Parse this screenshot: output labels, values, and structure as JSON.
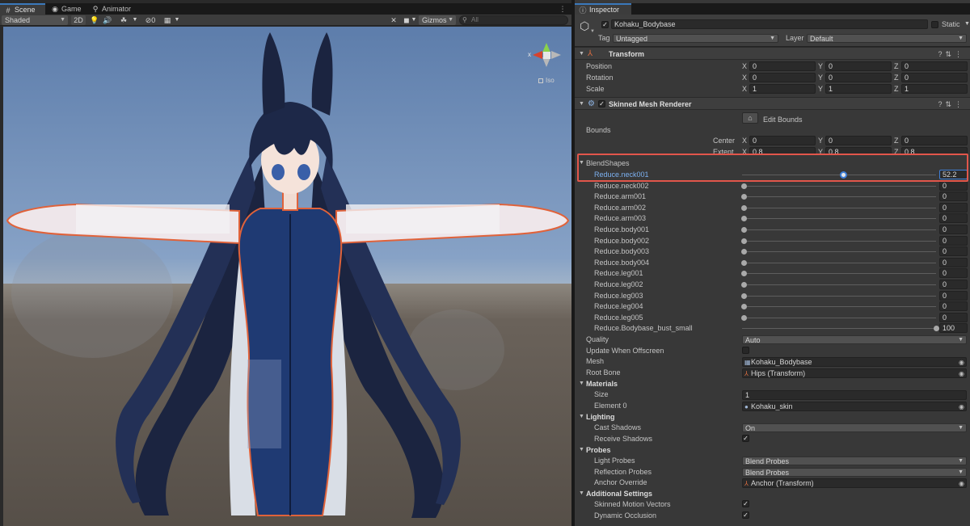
{
  "scene_tabs": [
    {
      "label": "Scene",
      "icon": "#"
    },
    {
      "label": "Game",
      "icon": "◉"
    },
    {
      "label": "Animator",
      "icon": "⚲"
    }
  ],
  "scene_toolbar": {
    "shading_mode": "Shaded",
    "mode_2d": "2D",
    "hidden_count": "0",
    "gizmos_label": "Gizmos",
    "search_placeholder": "All"
  },
  "viewport": {
    "axis_x_label": "x",
    "iso_label": "Iso",
    "colors": {
      "sky": "#5a7aa8",
      "ground": "#5f5850",
      "outline": "#e0623a",
      "hair": "#1b2440",
      "suit": "#1f3a73",
      "skin": "#f1dcd2"
    }
  },
  "inspector": {
    "tab_label": "Inspector",
    "object_name": "Kohaku_Bodybase",
    "static_label": "Static",
    "tag_label": "Tag",
    "tag_value": "Untagged",
    "layer_label": "Layer",
    "layer_value": "Default",
    "transform": {
      "title": "Transform",
      "rows": [
        {
          "label": "Position",
          "x": "0",
          "y": "0",
          "z": "0"
        },
        {
          "label": "Rotation",
          "x": "0",
          "y": "0",
          "z": "0"
        },
        {
          "label": "Scale",
          "x": "1",
          "y": "1",
          "z": "1"
        }
      ]
    },
    "smr": {
      "title": "Skinned Mesh Renderer",
      "edit_bounds_label": "Edit Bounds",
      "bounds_label": "Bounds",
      "center_label": "Center",
      "center": {
        "x": "0",
        "y": "0",
        "z": "0"
      },
      "extent_label": "Extent",
      "extent": {
        "x": "0.8",
        "y": "0.8",
        "z": "0.8"
      },
      "blendshapes_label": "BlendShapes",
      "blendshapes": [
        {
          "name": "Reduce.neck001",
          "value": "52.2",
          "fraction": 0.522
        },
        {
          "name": "Reduce.neck002",
          "value": "0",
          "fraction": 0
        },
        {
          "name": "Reduce.arm001",
          "value": "0",
          "fraction": 0
        },
        {
          "name": "Reduce.arm002",
          "value": "0",
          "fraction": 0
        },
        {
          "name": "Reduce.arm003",
          "value": "0",
          "fraction": 0
        },
        {
          "name": "Reduce.body001",
          "value": "0",
          "fraction": 0
        },
        {
          "name": "Reduce.body002",
          "value": "0",
          "fraction": 0
        },
        {
          "name": "Reduce.body003",
          "value": "0",
          "fraction": 0
        },
        {
          "name": "Reduce.body004",
          "value": "0",
          "fraction": 0
        },
        {
          "name": "Reduce.leg001",
          "value": "0",
          "fraction": 0
        },
        {
          "name": "Reduce.leg002",
          "value": "0",
          "fraction": 0
        },
        {
          "name": "Reduce.leg003",
          "value": "0",
          "fraction": 0
        },
        {
          "name": "Reduce.leg004",
          "value": "0",
          "fraction": 0
        },
        {
          "name": "Reduce.leg005",
          "value": "0",
          "fraction": 0
        },
        {
          "name": "Reduce.Bodybase_bust_small",
          "value": "100",
          "fraction": 1
        }
      ],
      "quality_label": "Quality",
      "quality_value": "Auto",
      "update_offscreen_label": "Update When Offscreen",
      "mesh_label": "Mesh",
      "mesh_value": "Kohaku_Bodybase",
      "root_bone_label": "Root Bone",
      "root_bone_value": "Hips (Transform)",
      "materials_label": "Materials",
      "size_label": "Size",
      "size_value": "1",
      "element0_label": "Element 0",
      "element0_value": "Kohaku_skin",
      "lighting_label": "Lighting",
      "cast_shadows_label": "Cast Shadows",
      "cast_shadows_value": "On",
      "receive_shadows_label": "Receive Shadows",
      "probes_label": "Probes",
      "light_probes_label": "Light Probes",
      "light_probes_value": "Blend Probes",
      "reflection_probes_label": "Reflection Probes",
      "reflection_probes_value": "Blend Probes",
      "anchor_override_label": "Anchor Override",
      "anchor_override_value": "Anchor (Transform)",
      "additional_label": "Additional Settings",
      "skinned_motion_label": "Skinned Motion Vectors",
      "dynamic_occlusion_label": "Dynamic Occlusion"
    }
  }
}
